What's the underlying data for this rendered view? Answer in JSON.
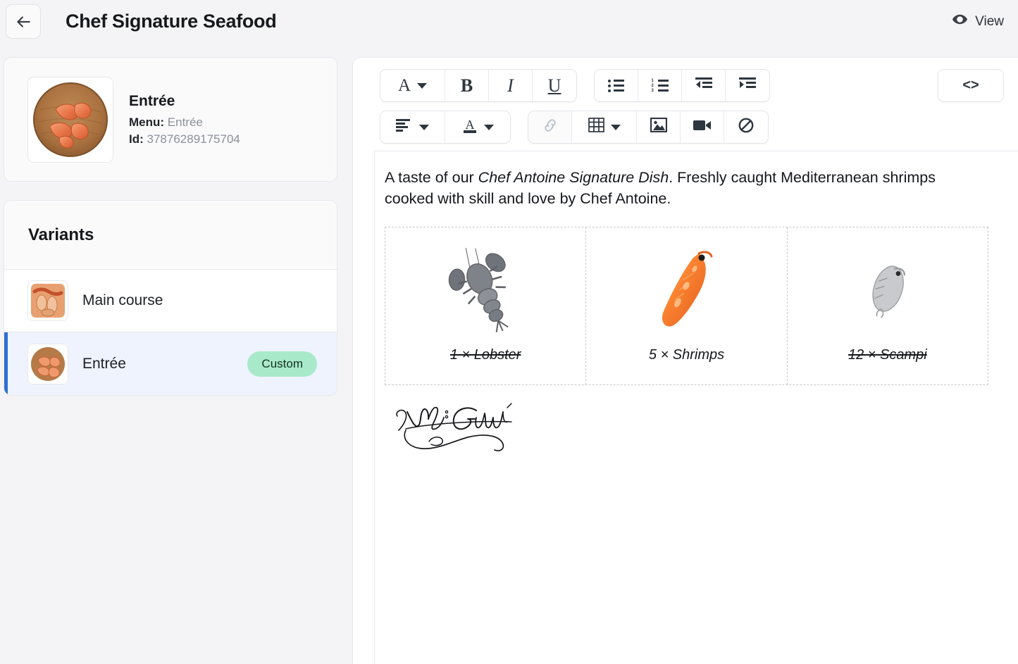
{
  "header": {
    "back_icon": "arrow-left-icon",
    "title": "Chef Signature Seafood",
    "view_label": "View",
    "view_icon": "eye-icon"
  },
  "sidebar": {
    "info": {
      "thumbnail_alt": "shrimps-in-wooden-bowl",
      "name": "Entrée",
      "menu_label": "Menu:",
      "menu_value": "Entrée",
      "id_label": "Id:",
      "id_value": "37876289175704"
    },
    "variants": {
      "title": "Variants",
      "items": [
        {
          "label": "Main course",
          "badge": "",
          "selected": false,
          "thumbnail_alt": "main-course-dish"
        },
        {
          "label": "Entrée",
          "badge": "Custom",
          "selected": true,
          "thumbnail_alt": "entree-dish"
        }
      ]
    }
  },
  "editor": {
    "toolbar": {
      "row1": [
        {
          "name": "font-family-button",
          "glyph": "A",
          "caret": true,
          "serif": true,
          "disabled": false
        },
        {
          "name": "bold-button",
          "glyph": "B",
          "caret": false,
          "serif": true,
          "disabled": false
        },
        {
          "name": "italic-button",
          "glyph": "I",
          "caret": false,
          "serif": true,
          "disabled": false
        },
        {
          "name": "underline-button",
          "glyph": "U",
          "caret": false,
          "serif": true,
          "disabled": false
        },
        {
          "name": "bullet-list-button",
          "glyph": "",
          "caret": false,
          "serif": false,
          "disabled": false
        },
        {
          "name": "numbered-list-button",
          "glyph": "",
          "caret": false,
          "serif": false,
          "disabled": false
        },
        {
          "name": "outdent-button",
          "glyph": "",
          "caret": false,
          "serif": false,
          "disabled": false
        },
        {
          "name": "indent-button",
          "glyph": "",
          "caret": false,
          "serif": false,
          "disabled": false
        },
        {
          "name": "code-view-button",
          "glyph": "<>",
          "caret": false,
          "serif": false,
          "disabled": false
        }
      ],
      "row2": [
        {
          "name": "align-button",
          "caret": true,
          "disabled": false
        },
        {
          "name": "font-color-button",
          "caret": true,
          "disabled": false
        },
        {
          "name": "link-button",
          "caret": false,
          "disabled": true
        },
        {
          "name": "table-button",
          "caret": true,
          "disabled": false
        },
        {
          "name": "insert-image-button",
          "caret": false,
          "disabled": false
        },
        {
          "name": "insert-video-button",
          "caret": false,
          "disabled": false
        },
        {
          "name": "clear-formatting-button",
          "caret": false,
          "disabled": false
        }
      ]
    },
    "body": {
      "paragraph_part1": "A taste of our ",
      "paragraph_emphasis": "Chef Antoine Signature Dish",
      "paragraph_part2": ". Freshly caught Mediterranean shrimps cooked with skill and love by Chef Antoine.",
      "cells": [
        {
          "label": "1 × Lobster",
          "struck": true,
          "image": "lobster-grayscale"
        },
        {
          "label": "5 × Shrimps",
          "struck": false,
          "image": "shrimp-orange"
        },
        {
          "label": "12 × Scampi",
          "struck": true,
          "image": "scampi-grayscale"
        }
      ],
      "signature_alt": "handwritten-signature-ant-gaudi"
    }
  },
  "colors": {
    "page_background": "#f4f4f6",
    "card_background": "#fafafb",
    "selected_row": "#eef3fd",
    "selected_accent": "#2f6fd0",
    "badge_background": "#a8e9ca",
    "border": "#e7e8ec",
    "muted_text": "#8b9099",
    "toolbar_icon": "#2e3640",
    "disabled_icon": "#b9c3cf"
  }
}
